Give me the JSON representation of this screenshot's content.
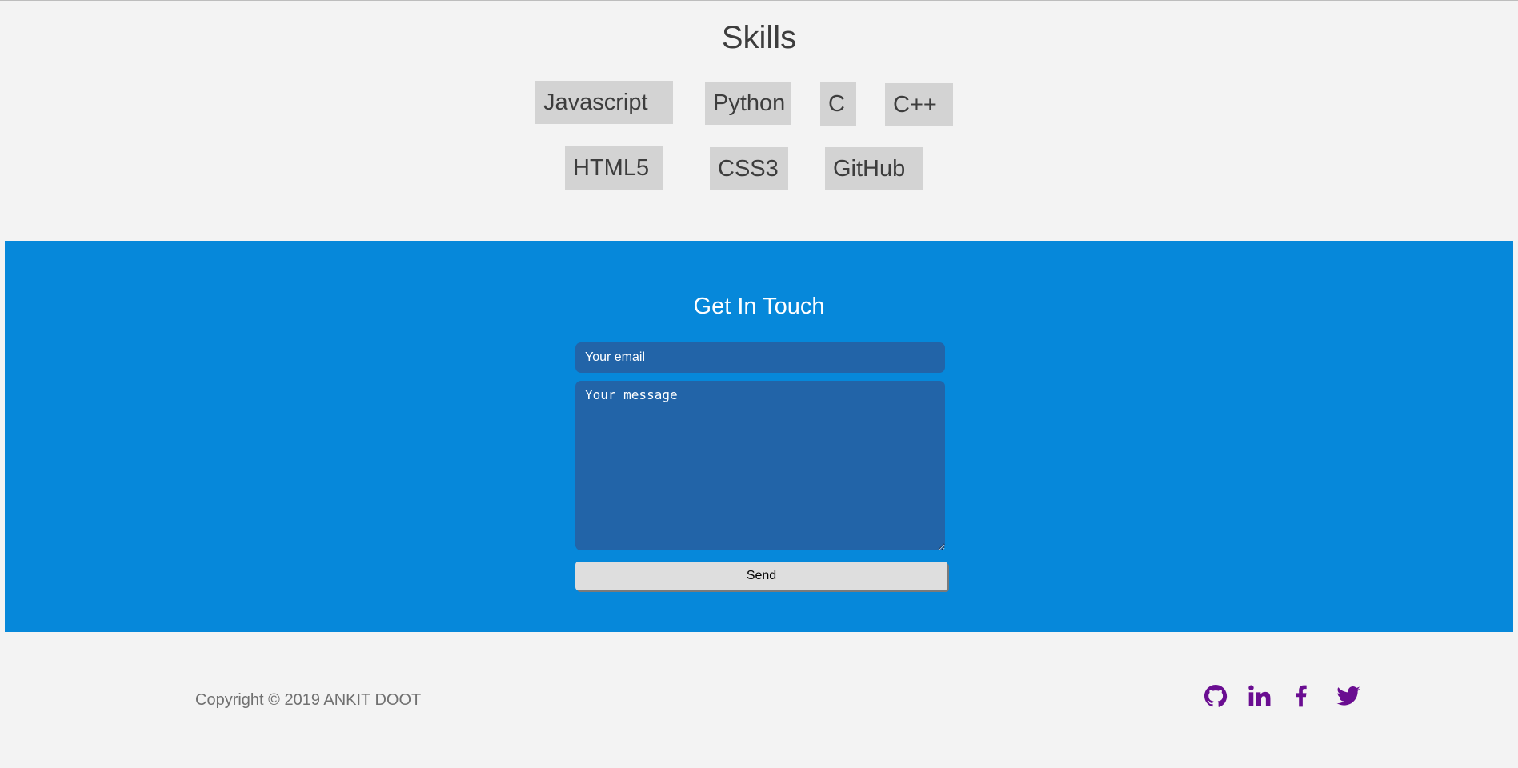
{
  "skills": {
    "title": "Skills",
    "items": [
      "Javascript",
      "Python",
      "C",
      "C++",
      "HTML5",
      "CSS3",
      "GitHub"
    ]
  },
  "contact": {
    "title": "Get In Touch",
    "email_placeholder": "Your email",
    "message_placeholder": "Your message",
    "send_label": "Send"
  },
  "footer": {
    "copyright": "Copyright © 2019 ANKIT DOOT",
    "social_icons": [
      "github-icon",
      "linkedin-icon",
      "facebook-icon",
      "twitter-icon"
    ]
  },
  "colors": {
    "page_background": "#f3f3f3",
    "contact_background": "#0688da",
    "field_background": "#2264a8",
    "skill_chip": "#d3d3d3",
    "social_icon": "#6a0d91"
  }
}
